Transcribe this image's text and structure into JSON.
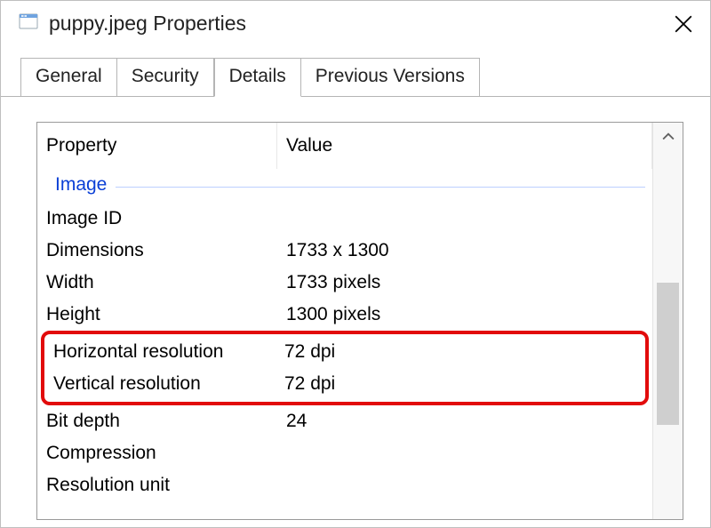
{
  "window": {
    "title": "puppy.jpeg Properties"
  },
  "tabs": {
    "general": "General",
    "security": "Security",
    "details": "Details",
    "previous": "Previous Versions"
  },
  "headers": {
    "property": "Property",
    "value": "Value"
  },
  "section": {
    "image": "Image"
  },
  "rows": {
    "image_id": {
      "label": "Image ID",
      "value": ""
    },
    "dimensions": {
      "label": "Dimensions",
      "value": "1733 x 1300"
    },
    "width": {
      "label": "Width",
      "value": "1733 pixels"
    },
    "height": {
      "label": "Height",
      "value": "1300 pixels"
    },
    "h_res": {
      "label": "Horizontal resolution",
      "value": "72 dpi"
    },
    "v_res": {
      "label": "Vertical resolution",
      "value": "72 dpi"
    },
    "bit_depth": {
      "label": "Bit depth",
      "value": "24"
    },
    "compression": {
      "label": "Compression",
      "value": ""
    },
    "res_unit": {
      "label": "Resolution unit",
      "value": ""
    }
  }
}
